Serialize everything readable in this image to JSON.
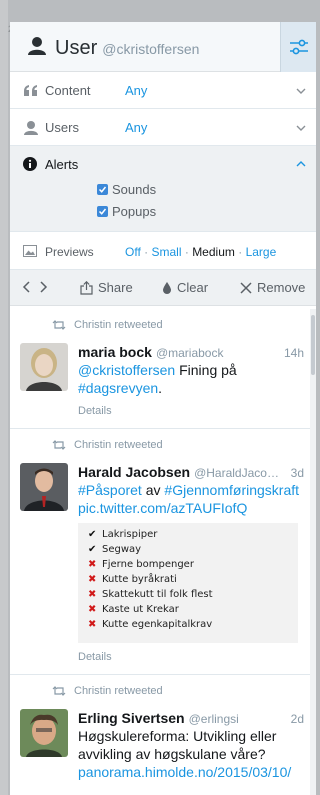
{
  "window": {
    "gutter_number": "23"
  },
  "header": {
    "title": "User",
    "handle": "@ckristoffersen"
  },
  "options": {
    "content": {
      "label": "Content",
      "value": "Any"
    },
    "users": {
      "label": "Users",
      "value": "Any"
    },
    "alerts": {
      "label": "Alerts",
      "sounds": "Sounds",
      "popups": "Popups"
    },
    "previews": {
      "label": "Previews",
      "off": "Off",
      "small": "Small",
      "medium": "Medium",
      "large": "Large",
      "sep": "·"
    }
  },
  "toolbar": {
    "share": "Share",
    "clear": "Clear",
    "remove": "Remove"
  },
  "tweets": [
    {
      "retweeted_by": "Christin retweeted",
      "name": "maria bock",
      "handle": "@mariabock",
      "time": "14h",
      "mention": "@ckristoffersen",
      "text": " Fining på",
      "hashtag": "#dagsrevyen",
      "tail": ".",
      "details": "Details"
    },
    {
      "retweeted_by": "Christin retweeted",
      "name": "Harald Jacobsen",
      "handle": "@HaraldJaco…",
      "time": "3d",
      "hashtag1": "#Påsporet",
      "mid": " av ",
      "hashtag2": "#Gjennomføringskraft",
      "link": "pic.twitter.com/azTAUFIofQ",
      "list": [
        {
          "mark": "✔",
          "ok": true,
          "text": "Lakrispiper"
        },
        {
          "mark": "✔",
          "ok": true,
          "text": "Segway"
        },
        {
          "mark": "✖",
          "ok": false,
          "text": "Fjerne bompenger"
        },
        {
          "mark": "✖",
          "ok": false,
          "text": "Kutte byråkrati"
        },
        {
          "mark": "✖",
          "ok": false,
          "text": "Skattekutt til folk flest"
        },
        {
          "mark": "✖",
          "ok": false,
          "text": "Kaste ut Krekar"
        },
        {
          "mark": "✖",
          "ok": false,
          "text": "Kutte egenkapitalkrav"
        }
      ],
      "details": "Details"
    },
    {
      "retweeted_by": "Christin retweeted",
      "name": "Erling Sivertsen",
      "handle": "@erlingsi",
      "time": "2d",
      "text": "Høgskulereforma: Utvikling eller avvikling av høgskulane våre?",
      "link": "panorama.himolde.no/2015/03/10/"
    }
  ],
  "colors": {
    "accent": "#1b95e0",
    "muted": "#8899a6",
    "no_mark": "#d11a1a"
  }
}
